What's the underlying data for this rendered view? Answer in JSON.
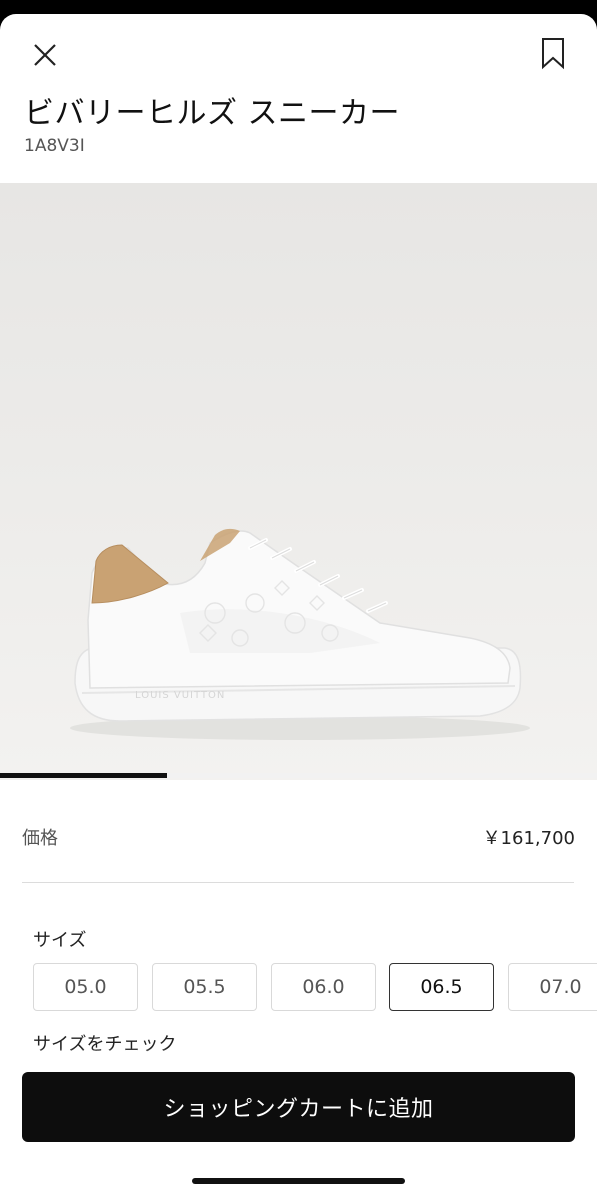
{
  "header": {
    "close_icon": "close-icon",
    "bookmark_icon": "bookmark-icon"
  },
  "product": {
    "title": "ビバリーヒルズ スニーカー",
    "sku": "1A8V3I",
    "image_icon": "sneaker-image",
    "image_progress": 0.28,
    "sole_text": "LOUIS VUITTON"
  },
  "price": {
    "label": "価格",
    "value": "￥161,700"
  },
  "sizes": {
    "heading": "サイズ",
    "options": [
      "05.0",
      "05.5",
      "06.0",
      "06.5",
      "07.0"
    ],
    "selected": "06.5",
    "check_link": "サイズをチェック"
  },
  "cta": {
    "add_to_cart": "ショッピングカートに追加"
  },
  "colors": {
    "accent": "#0d0d0d",
    "heel_tab": "#c9a273"
  }
}
